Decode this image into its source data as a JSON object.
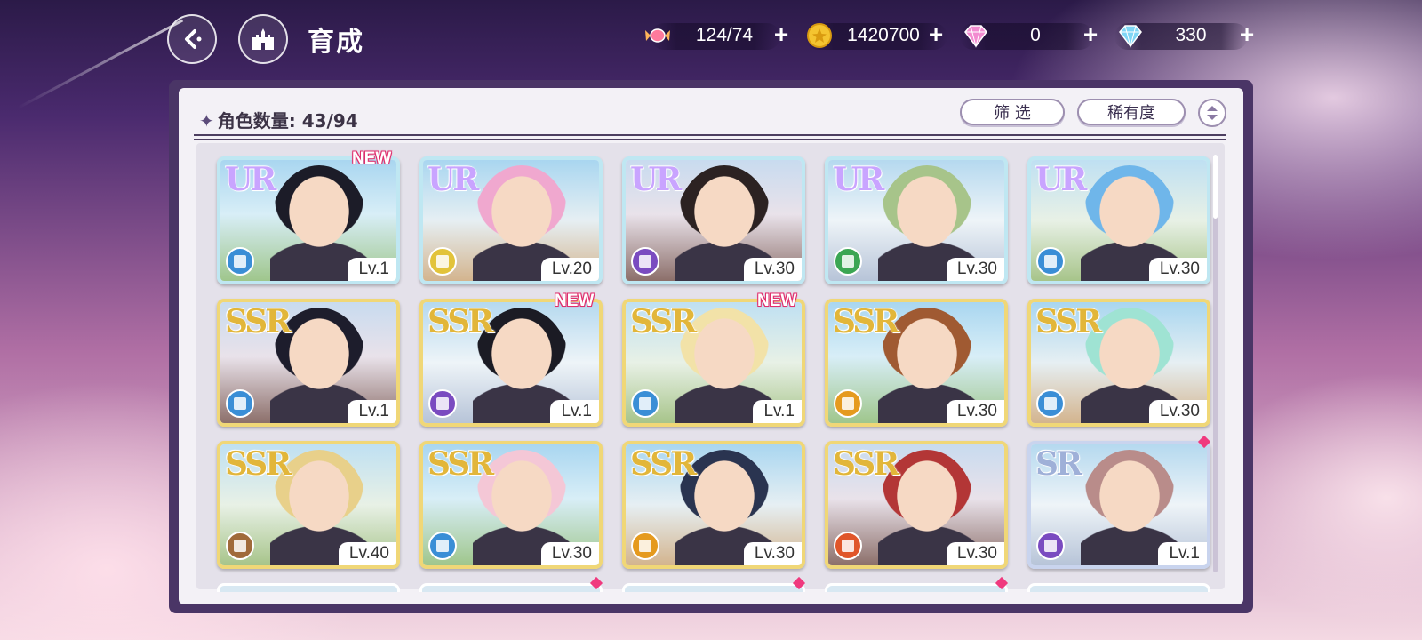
{
  "header": {
    "title": "育成"
  },
  "resources": [
    {
      "name": "candy",
      "value": "124/74",
      "color": "#ff7a9c"
    },
    {
      "name": "gold-coin",
      "value": "1420700",
      "color": "#f4c430"
    },
    {
      "name": "pink-gem",
      "value": "0",
      "color": "#f28bd0"
    },
    {
      "name": "blue-gem",
      "value": "330",
      "color": "#7fd6f5"
    }
  ],
  "panel": {
    "count_label": "角色数量: 43/94",
    "filter_label": "筛 选",
    "rarity_label": "稀有度"
  },
  "cards": [
    {
      "rarity": "UR",
      "level": "Lv.1",
      "new": "NEW",
      "type_color": "#3a8ed6",
      "hair": "#1c1c28"
    },
    {
      "rarity": "UR",
      "level": "Lv.20",
      "new": "",
      "type_color": "#e2c33a",
      "hair": "#f0a8cf"
    },
    {
      "rarity": "UR",
      "level": "Lv.30",
      "new": "",
      "type_color": "#7a4bc0",
      "hair": "#2c2222"
    },
    {
      "rarity": "UR",
      "level": "Lv.30",
      "new": "",
      "type_color": "#3ba653",
      "hair": "#a7c48a"
    },
    {
      "rarity": "UR",
      "level": "Lv.30",
      "new": "",
      "type_color": "#3a8ed6",
      "hair": "#6fb6ea"
    },
    {
      "rarity": "SSR",
      "level": "Lv.1",
      "new": "",
      "type_color": "#3a8ed6",
      "hair": "#1d1d2c"
    },
    {
      "rarity": "SSR",
      "level": "Lv.1",
      "new": "NEW",
      "type_color": "#7a4bc0",
      "hair": "#1b1b24"
    },
    {
      "rarity": "SSR",
      "level": "Lv.1",
      "new": "NEW",
      "type_color": "#3a8ed6",
      "hair": "#f2e2a8"
    },
    {
      "rarity": "SSR",
      "level": "Lv.30",
      "new": "",
      "type_color": "#e59a1e",
      "hair": "#a05a32"
    },
    {
      "rarity": "SSR",
      "level": "Lv.30",
      "new": "",
      "type_color": "#3a8ed6",
      "hair": "#9fe3d3"
    },
    {
      "rarity": "SSR",
      "level": "Lv.40",
      "new": "",
      "type_color": "#a06a3a",
      "hair": "#e8d08a"
    },
    {
      "rarity": "SSR",
      "level": "Lv.30",
      "new": "",
      "type_color": "#3a8ed6",
      "hair": "#f4c7d6"
    },
    {
      "rarity": "SSR",
      "level": "Lv.30",
      "new": "",
      "type_color": "#e59a1e",
      "hair": "#2a3450"
    },
    {
      "rarity": "SSR",
      "level": "Lv.30",
      "new": "",
      "type_color": "#e0562a",
      "hair": "#b33636"
    },
    {
      "rarity": "SR",
      "level": "Lv.1",
      "new": "",
      "type_color": "#7a4bc0",
      "hair": "#b98c8a"
    }
  ]
}
